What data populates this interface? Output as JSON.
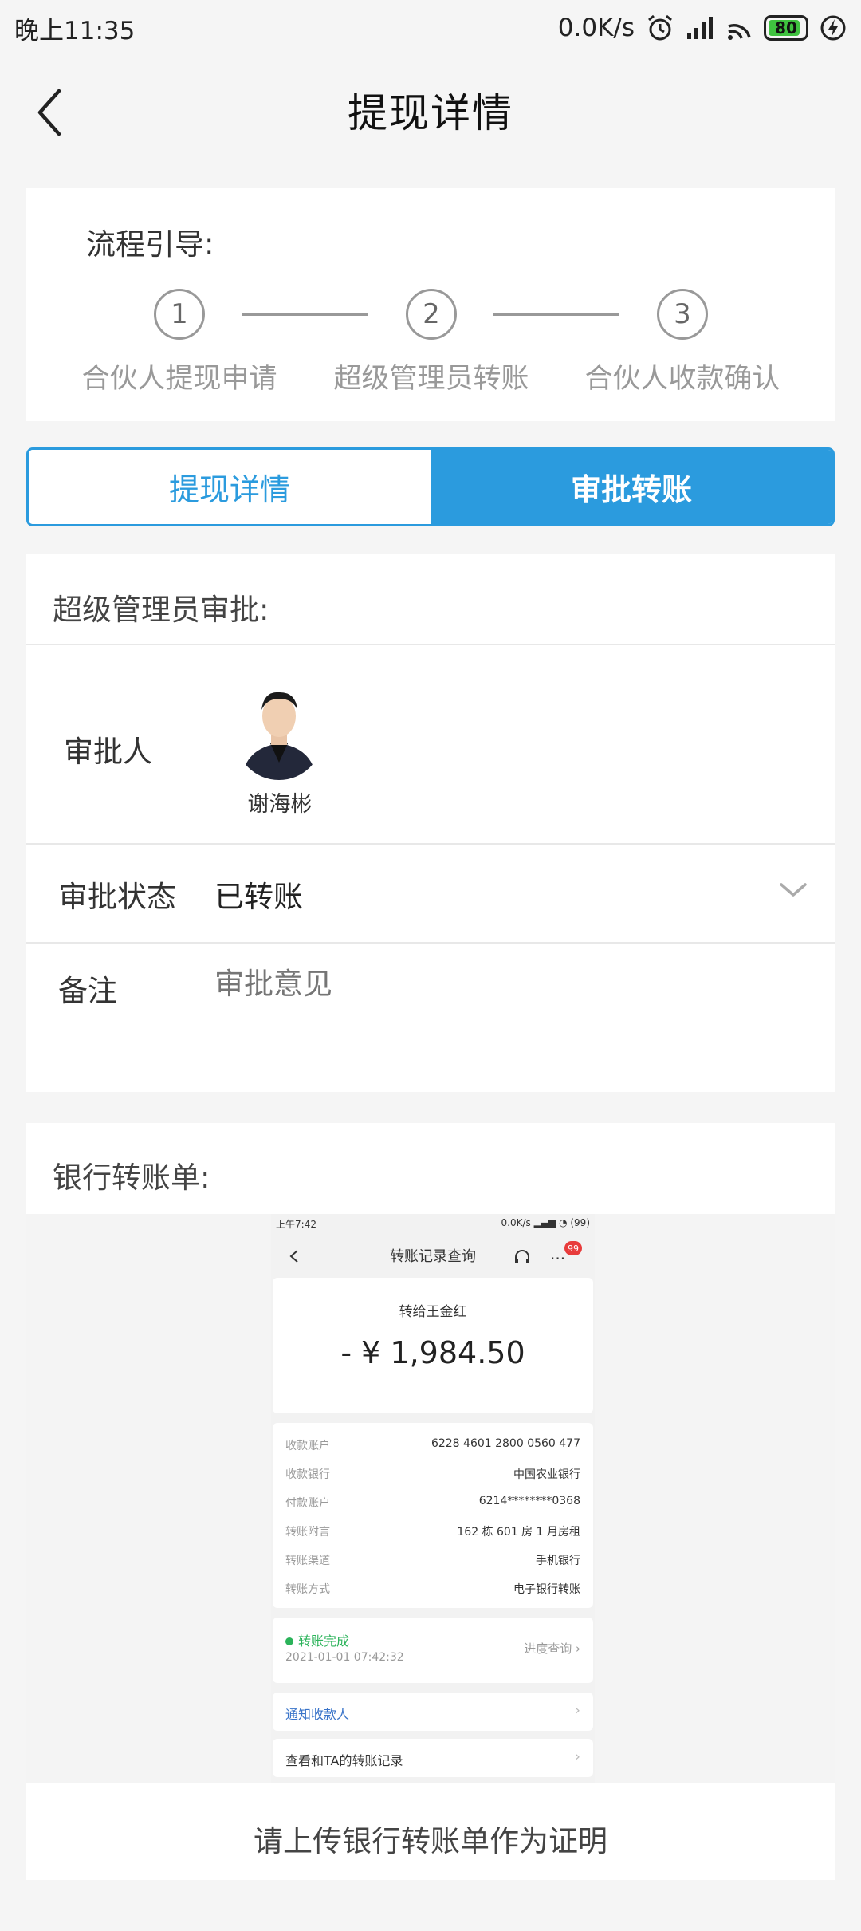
{
  "status_bar": {
    "time": "晚上11:35",
    "net_speed": "0.0K/s",
    "battery": "80"
  },
  "header": {
    "title": "提现详情",
    "back_icon": "chevron-left-icon"
  },
  "guide": {
    "title": "流程引导:",
    "steps": [
      {
        "num": "1",
        "label": "合伙人提现申请"
      },
      {
        "num": "2",
        "label": "超级管理员转账"
      },
      {
        "num": "3",
        "label": "合伙人收款确认"
      }
    ]
  },
  "tabs": [
    {
      "label": "提现详情",
      "active": false
    },
    {
      "label": "审批转账",
      "active": true
    }
  ],
  "approval": {
    "title": "超级管理员审批:",
    "approver_label": "审批人",
    "approver_name": "谢海彬",
    "status_label": "审批状态",
    "status_value": "已转账",
    "remark_label": "备注",
    "remark_placeholder": "审批意见"
  },
  "bank": {
    "title": "银行转账单:",
    "upload_hint": "请上传银行转账单作为证明",
    "receipt": {
      "time": "上午7:42",
      "speed": "0.0K/s",
      "battery": "99",
      "title": "转账记录查询",
      "badge": "99",
      "to": "转给王金红",
      "amount": "- ¥ 1,984.50",
      "rows": [
        {
          "k": "收款账户",
          "v": "6228 4601 2800 0560 477"
        },
        {
          "k": "收款银行",
          "v": "中国农业银行"
        },
        {
          "k": "付款账户",
          "v": "6214********0368"
        },
        {
          "k": "转账附言",
          "v": "162 栋 601 房 1 月房租"
        },
        {
          "k": "转账渠道",
          "v": "手机银行"
        },
        {
          "k": "转账方式",
          "v": "电子银行转账"
        }
      ],
      "done": "转账完成",
      "done_time": "2021-01-01 07:42:32",
      "progress": "进度查询",
      "notify": "通知收款人",
      "history": "查看和TA的转账记录"
    }
  },
  "colors": {
    "accent": "#2b9bde",
    "success": "#2bb35a",
    "badge": "#e83b3b"
  }
}
